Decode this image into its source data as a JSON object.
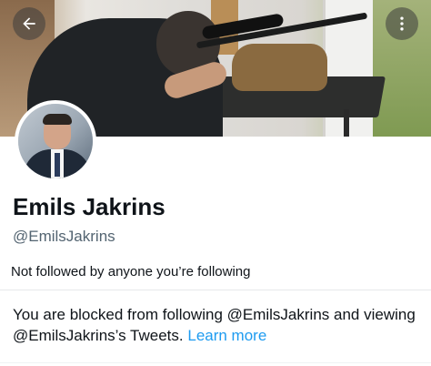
{
  "header": {
    "back_icon": "arrow-left-icon",
    "more_icon": "more-vertical-icon"
  },
  "profile": {
    "display_name": "Emils Jakrins",
    "handle": "@EmilsJakrins",
    "followed_by": "Not followed by anyone you’re following"
  },
  "blocked_notice": {
    "text": "You are blocked from following @EmilsJakrins and viewing @EmilsJakrins’s Tweets.",
    "link_label": "Learn more"
  },
  "colors": {
    "link": "#1d9bf0",
    "secondary_text": "#536471",
    "primary_text": "#0f1419"
  }
}
